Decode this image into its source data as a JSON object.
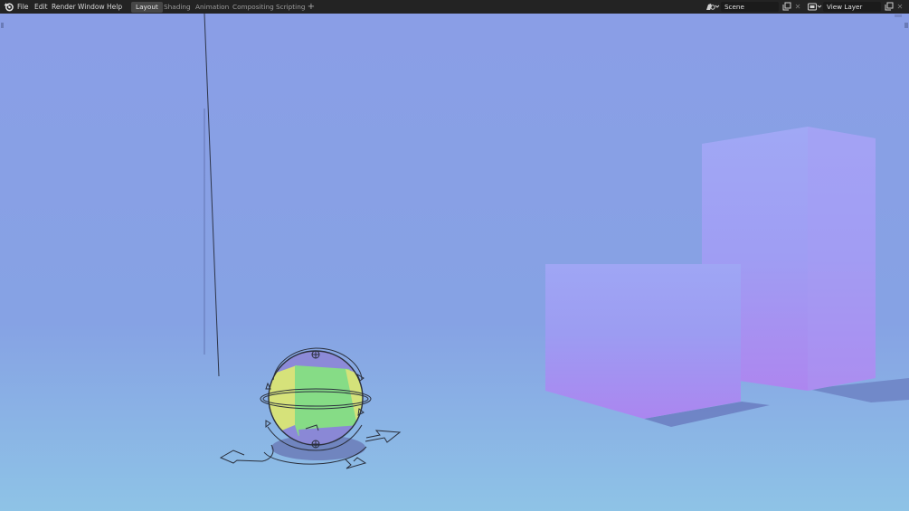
{
  "menu": {
    "file": "File",
    "edit": "Edit",
    "render": "Render",
    "window": "Window",
    "help": "Help"
  },
  "workspaces": {
    "layout": "Layout",
    "shading": "Shading",
    "animation": "Animation",
    "compositing": "Compositing",
    "scripting": "Scripting",
    "add": "+"
  },
  "scene": {
    "name": "Scene"
  },
  "view_layer": {
    "name": "View Layer"
  },
  "icons": {
    "logo": "blender-logo-icon",
    "scene_selector": "scene-icon",
    "view_layer_selector": "render-layers-icon",
    "copy": "duplicate-icon",
    "close": "close-icon"
  },
  "colors": {
    "sky_top": "#8a9ee6",
    "sky_horizon": "#86a2e4",
    "floor_bottom": "#8ec0e6",
    "cube_top": "#9da3f4",
    "cube_bottom": "#a987f0",
    "sphere_green": "#86dc86",
    "sphere_yellow": "#d6e27a",
    "sphere_purple": "#8c8ad8"
  }
}
